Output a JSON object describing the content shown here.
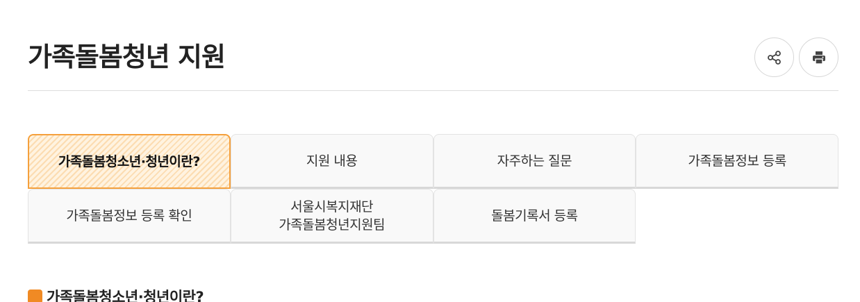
{
  "page": {
    "title": "가족돌봄청년 지원"
  },
  "header": {
    "share_icon": "share-icon",
    "print_icon": "print-icon"
  },
  "tabs": [
    {
      "label": "가족돌봄청소년·청년이란?",
      "active": true
    },
    {
      "label": "지원 내용",
      "active": false
    },
    {
      "label": "자주하는 질문",
      "active": false
    },
    {
      "label": "가족돌봄정보 등록",
      "active": false
    },
    {
      "label": "가족돌봄정보 등록 확인",
      "active": false
    },
    {
      "label_line1": "서울시복지재단",
      "label_line2": "가족돌봄청년지원팀",
      "active": false
    },
    {
      "label": "돌봄기록서 등록",
      "active": false
    }
  ],
  "section": {
    "title": "가족돌봄청소년·청년이란?"
  },
  "colors": {
    "accent": "#f5a03c",
    "section_icon": "#f08a24",
    "tab_bg": "#f9f9f9"
  }
}
